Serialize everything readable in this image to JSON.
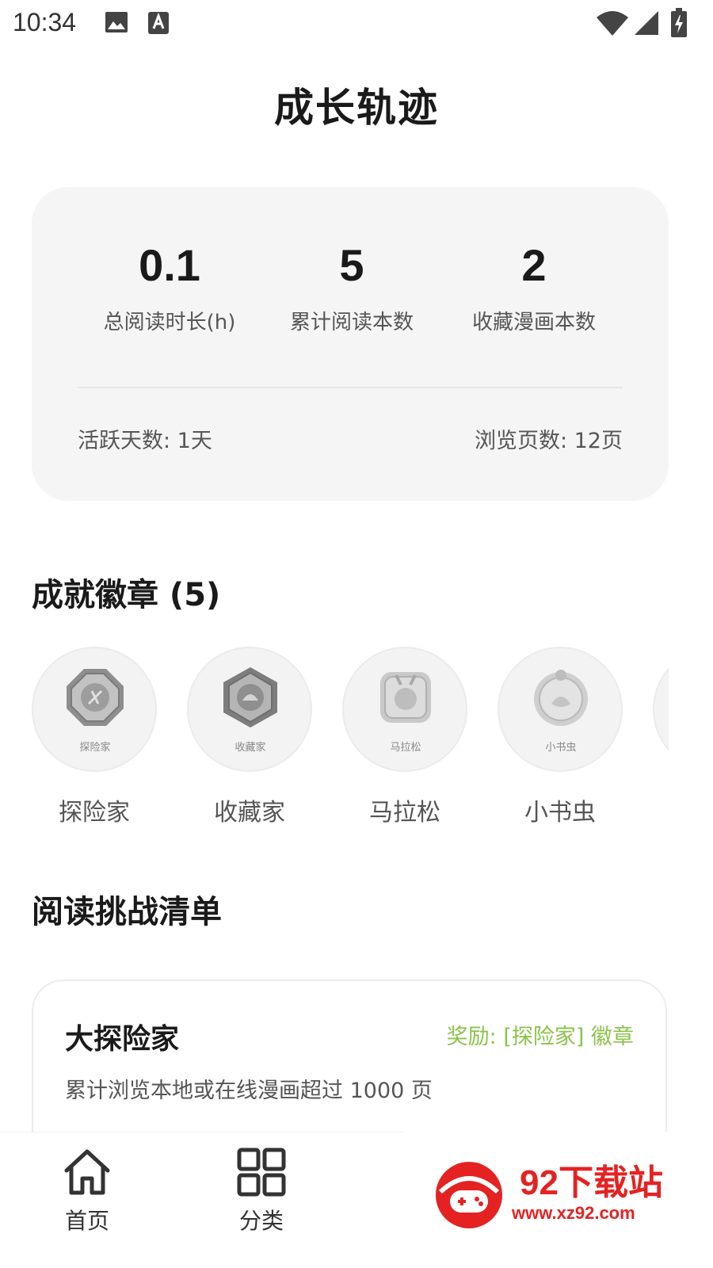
{
  "status_bar": {
    "time": "10:34",
    "icons": [
      "image-icon",
      "text-a-icon",
      "wifi-icon",
      "signal-icon",
      "battery-charging-icon"
    ]
  },
  "page": {
    "title": "成长轨迹"
  },
  "stats": {
    "total_reading_hours": {
      "value": "0.1",
      "label": "总阅读时长(h)"
    },
    "books_read": {
      "value": "5",
      "label": "累计阅读本数"
    },
    "comics_favorited": {
      "value": "2",
      "label": "收藏漫画本数"
    },
    "active_days": "活跃天数: 1天",
    "pages_viewed": "浏览页数: 12页"
  },
  "badges": {
    "title": "成就徽章 (5)",
    "items": [
      {
        "name": "探险家",
        "caption": "探险家",
        "icon": "explorer-medal-icon"
      },
      {
        "name": "收藏家",
        "caption": "收藏家",
        "icon": "collector-medal-icon"
      },
      {
        "name": "马拉松",
        "caption": "马拉松",
        "icon": "marathon-medal-icon"
      },
      {
        "name": "小书虫",
        "caption": "小书虫",
        "icon": "bookworm-medal-icon"
      }
    ]
  },
  "challenges": {
    "title": "阅读挑战清单",
    "items": [
      {
        "title": "大探险家",
        "reward": "奖励: [探险家] 徽章",
        "description": "累计浏览本地或在线漫画超过 1000 页"
      }
    ]
  },
  "nav": {
    "home": {
      "label": "首页",
      "icon": "home-icon"
    },
    "category": {
      "label": "分类",
      "icon": "grid-icon"
    }
  },
  "watermark": {
    "title": "92下载站",
    "url": "www.xz92.com"
  },
  "colors": {
    "reward": "#8bc34a",
    "card_bg": "#f5f5f5",
    "watermark": "#e52222"
  }
}
